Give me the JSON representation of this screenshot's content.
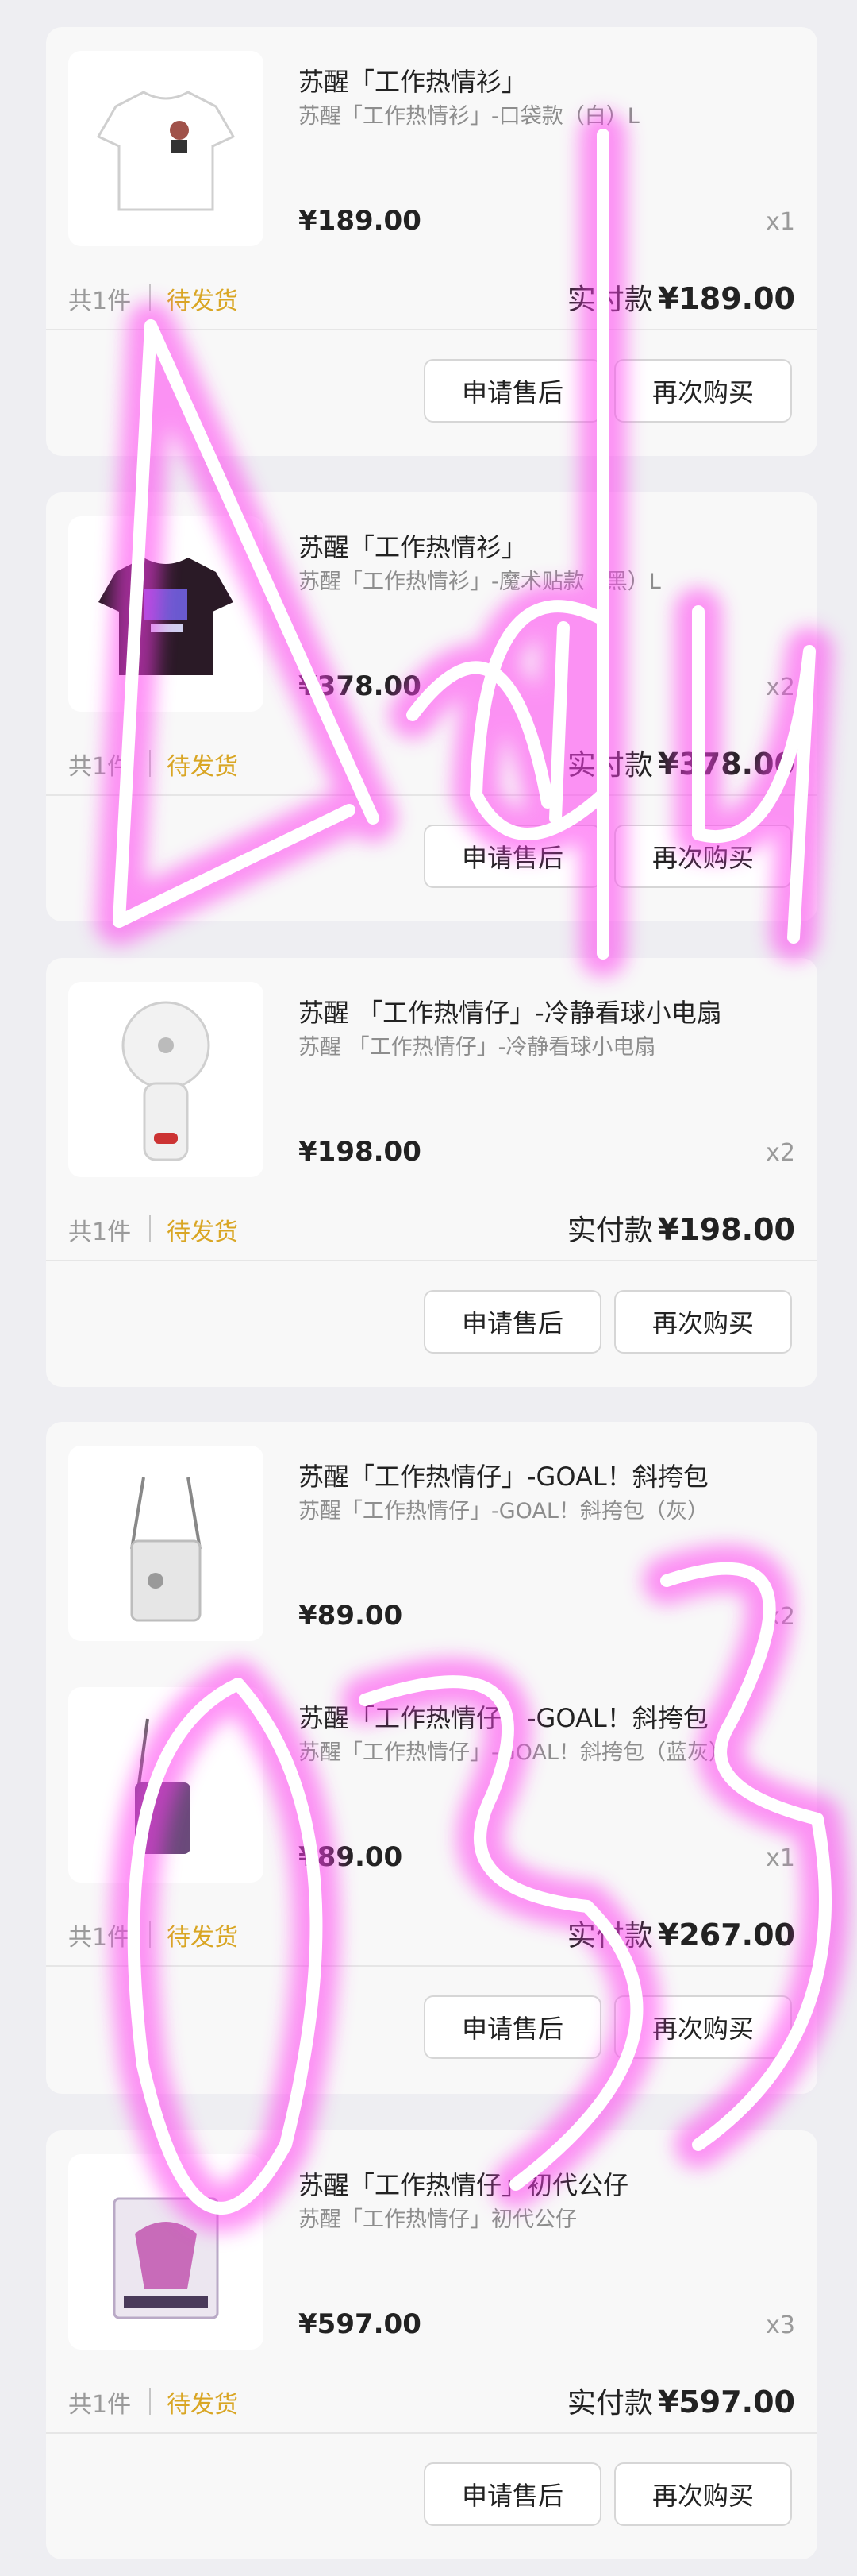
{
  "orders": [
    {
      "products": [
        {
          "title": "苏醒「工作热情衫」",
          "spec": "苏醒「工作热情衫」-口袋款（白）L",
          "price": "¥189.00",
          "qty": "x1",
          "icon": "white-tshirt-icon"
        }
      ],
      "count": "共1件",
      "status": "待发货",
      "paid_label": "实付款",
      "paid_amount": "¥189.00",
      "buttons": {
        "after_sale": "申请售后",
        "rebuy": "再次购买"
      }
    },
    {
      "products": [
        {
          "title": "苏醒「工作热情衫」",
          "spec": "苏醒「工作热情衫」-魔术贴款（黑）L",
          "price": "¥378.00",
          "qty": "x2",
          "icon": "black-tshirt-icon"
        }
      ],
      "count": "共1件",
      "status": "待发货",
      "paid_label": "实付款",
      "paid_amount": "¥378.00",
      "buttons": {
        "after_sale": "申请售后",
        "rebuy": "再次购买"
      }
    },
    {
      "products": [
        {
          "title": "苏醒 「工作热情仔」-冷静看球小电扇",
          "spec": "苏醒 「工作热情仔」-冷静看球小电扇",
          "price": "¥198.00",
          "qty": "x2",
          "icon": "mini-fan-icon"
        }
      ],
      "count": "共1件",
      "status": "待发货",
      "paid_label": "实付款",
      "paid_amount": "¥198.00",
      "buttons": {
        "after_sale": "申请售后",
        "rebuy": "再次购买"
      }
    },
    {
      "products": [
        {
          "title": "苏醒「工作热情仔」-GOAL！斜挎包",
          "spec": "苏醒「工作热情仔」-GOAL！斜挎包（灰）",
          "price": "¥89.00",
          "qty": "x2",
          "icon": "grey-crossbody-bag-icon"
        },
        {
          "title": "苏醒「工作热情仔」-GOAL！斜挎包",
          "spec": "苏醒「工作热情仔」-GOAL！斜挎包（蓝灰）",
          "price": "¥89.00",
          "qty": "x1",
          "icon": "bluegrey-crossbody-bag-icon"
        }
      ],
      "count": "共1件",
      "status": "待发货",
      "paid_label": "实付款",
      "paid_amount": "¥267.00",
      "buttons": {
        "after_sale": "申请售后",
        "rebuy": "再次购买"
      }
    },
    {
      "products": [
        {
          "title": "苏醒「工作热情仔」初代公仔",
          "spec": "苏醒「工作热情仔」初代公仔",
          "price": "¥597.00",
          "qty": "x3",
          "icon": "figure-box-icon"
        }
      ],
      "count": "共1件",
      "status": "待发货",
      "paid_label": "实付款",
      "paid_amount": "¥597.00",
      "buttons": {
        "after_sale": "申请售后",
        "rebuy": "再次购买"
      }
    }
  ],
  "overlay": {
    "text_top": "Andy",
    "text_bottom": "833",
    "color": "#ff3cf0"
  },
  "colors": {
    "status": "#d9a624",
    "background": "#eeeef2",
    "card": "#f8f8f8"
  }
}
